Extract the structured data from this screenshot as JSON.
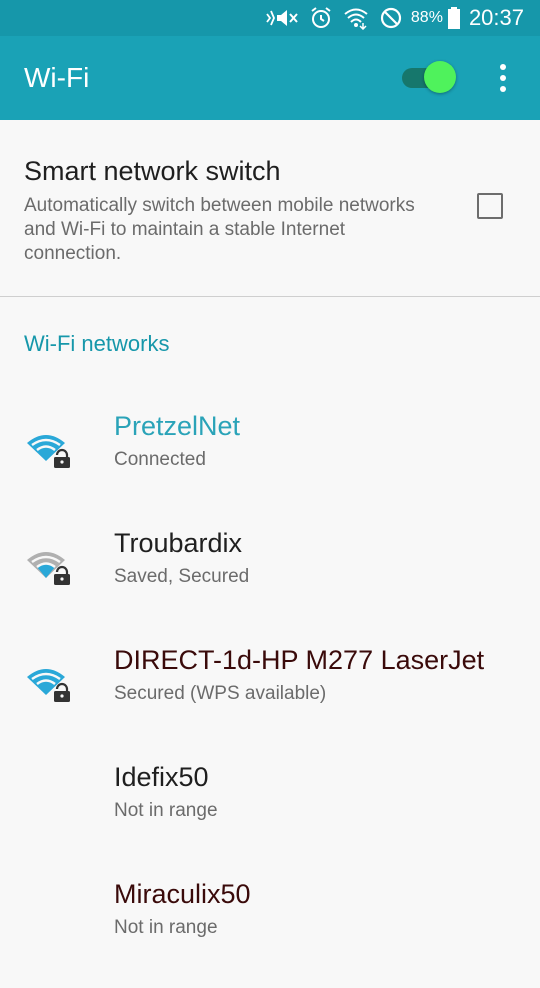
{
  "status_bar": {
    "battery": "88%",
    "time": "20:37",
    "icons": [
      "vibrate-mute-icon",
      "alarm-icon",
      "wifi-signal-icon",
      "do-not-disturb-icon",
      "battery-icon"
    ]
  },
  "app_bar": {
    "title": "Wi-Fi",
    "wifi_enabled": true
  },
  "smart_switch": {
    "title": "Smart network switch",
    "description": "Automatically switch between mobile networks and Wi-Fi to maintain a stable Internet connection.",
    "checked": false
  },
  "section_header": "Wi-Fi networks",
  "networks": [
    {
      "name": "PretzelNet",
      "status": "Connected",
      "icon": "wifi-lock-icon"
    },
    {
      "name": "Troubardix",
      "status": "Saved, Secured",
      "icon": "wifi-lock-icon"
    },
    {
      "name": "DIRECT-1d-HP M277 LaserJet",
      "status": "Secured (WPS available)",
      "icon": "wifi-lock-icon"
    },
    {
      "name": "Idefix50",
      "status": "Not in range"
    },
    {
      "name": "Miraculix50",
      "status": "Not in range"
    }
  ],
  "colors": {
    "accent": "#1aa2b6",
    "status_bar": "#1697aa",
    "toggle_thumb": "#4ff25c",
    "wifi_active": "#2aa8d8",
    "wifi_weak": "#b0b0b0"
  }
}
